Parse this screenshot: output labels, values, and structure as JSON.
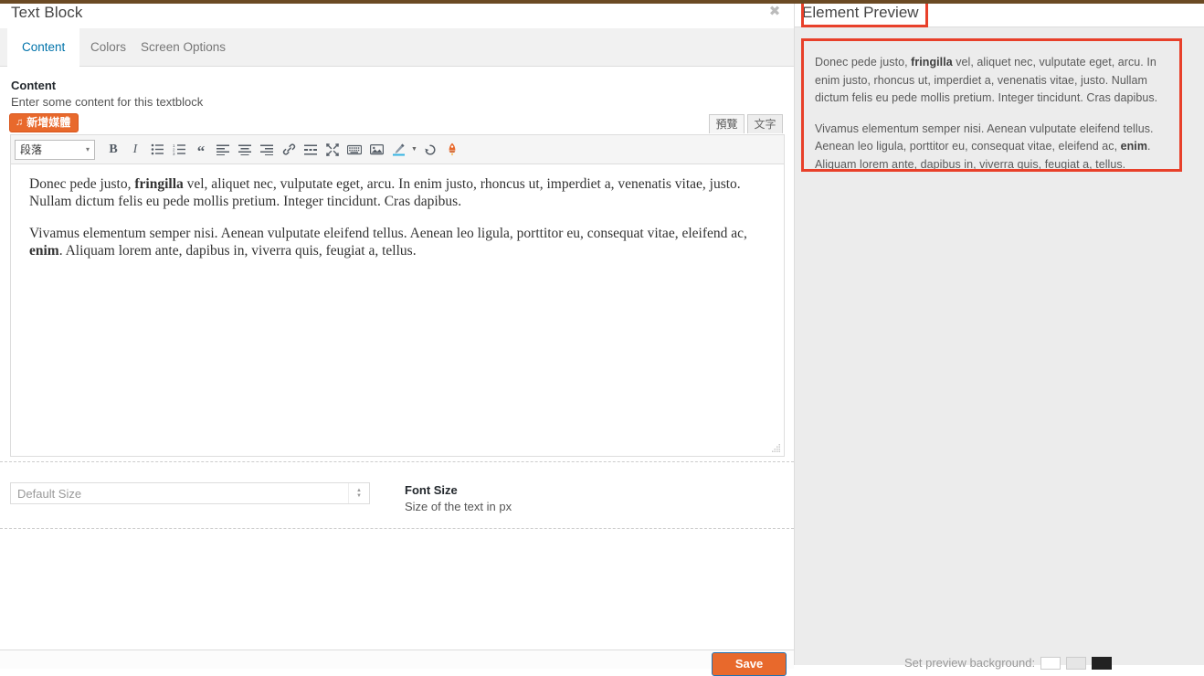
{
  "admin_bar": {
    "color": "#6b4a24"
  },
  "modal": {
    "title": "Text Block",
    "close_label": "✖"
  },
  "tabs": [
    {
      "label": "Content",
      "active": true
    },
    {
      "label": "Colors",
      "active": false
    },
    {
      "label": "Screen Options",
      "active": false
    }
  ],
  "content_section": {
    "heading": "Content",
    "description": "Enter some content for this textblock",
    "add_media_label": "新增媒體",
    "add_media_icon": "♫"
  },
  "editor_modes": [
    {
      "label": "預覽",
      "active": true
    },
    {
      "label": "文字",
      "active": false
    }
  ],
  "toolbar": {
    "format_select_value": "段落",
    "format_select_caret": "▾",
    "buttons": [
      {
        "name": "bold-icon",
        "label": "B"
      },
      {
        "name": "italic-icon",
        "label": "I"
      },
      {
        "name": "unordered-list-icon",
        "label": ""
      },
      {
        "name": "ordered-list-icon",
        "label": ""
      },
      {
        "name": "blockquote-icon",
        "label": "“"
      },
      {
        "name": "align-left-icon",
        "label": ""
      },
      {
        "name": "align-center-icon",
        "label": ""
      },
      {
        "name": "align-right-icon",
        "label": ""
      },
      {
        "name": "link-icon",
        "label": ""
      },
      {
        "name": "read-more-icon",
        "label": ""
      },
      {
        "name": "fullscreen-icon",
        "label": ""
      },
      {
        "name": "keyboard-shortcuts-icon",
        "label": ""
      },
      {
        "name": "insert-image-icon",
        "label": ""
      },
      {
        "name": "text-color-icon",
        "label": ""
      },
      {
        "name": "undo-icon",
        "label": ""
      },
      {
        "name": "rocket-icon",
        "label": ""
      }
    ]
  },
  "editor_content": {
    "paragraph_1_a": "Donec pede justo, ",
    "paragraph_1_bold": "fringilla",
    "paragraph_1_b": " vel, aliquet nec, vulputate eget, arcu. In enim justo, rhoncus ut, imperdiet a, venenatis vitae, justo. Nullam dictum felis eu pede mollis pretium. Integer tincidunt. Cras dapibus.",
    "paragraph_2_a": "Vivamus elementum semper nisi. Aenean vulputate eleifend tellus. Aenean leo ligula, porttitor eu, consequat vitae, eleifend ac, ",
    "paragraph_2_bold": "enim",
    "paragraph_2_b": ". Aliquam lorem ante, dapibus in, viverra quis, feugiat a, tellus."
  },
  "font_size_field": {
    "placeholder": "Default Size",
    "value": "",
    "label": "Font Size",
    "description": "Size of the text in px"
  },
  "footer": {
    "save_label": "Save",
    "save_color": "#e8692c"
  },
  "preview": {
    "title": "Element Preview",
    "background": "#ececec",
    "annotation_color": "#e8402a",
    "paragraph_1_a": "Donec pede justo, ",
    "paragraph_1_bold": "fringilla",
    "paragraph_1_b": " vel, aliquet nec, vulputate eget, arcu. In enim justo, rhoncus ut, imperdiet a, venenatis vitae, justo. Nullam dictum felis eu pede mollis pretium. Integer tincidunt. Cras dapibus.",
    "paragraph_2_a": "Vivamus elementum semper nisi. Aenean vulputate eleifend tellus. Aenean leo ligula, porttitor eu, consequat vitae, eleifend ac, ",
    "paragraph_2_bold": "enim",
    "paragraph_2_b": ". Aliquam lorem ante, dapibus in, viverra quis, feugiat a, tellus.",
    "bg_picker_label": "Set preview background:",
    "swatches": [
      "#ffffff",
      "#e6e6e6",
      "#222222"
    ]
  }
}
